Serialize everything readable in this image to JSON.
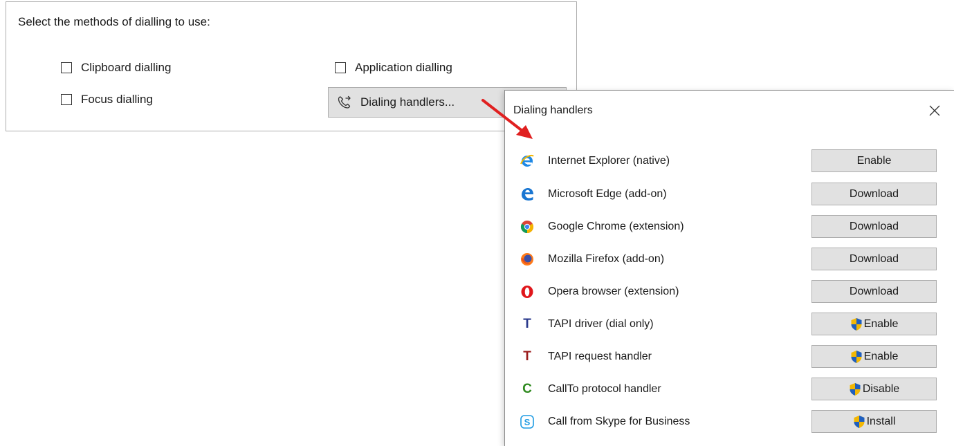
{
  "panel": {
    "title": "Select the methods of dialling to use:",
    "checkboxes": [
      {
        "label": "Clipboard dialling",
        "checked": false
      },
      {
        "label": "Application dialling",
        "checked": false
      },
      {
        "label": "Focus dialling",
        "checked": false
      }
    ],
    "handlers_button": {
      "label": "Dialing handlers...",
      "icon": "phone-forward-icon"
    }
  },
  "dialog": {
    "title": "Dialing handlers",
    "close_icon": "close-icon",
    "rows": [
      {
        "label": "Internet Explorer (native)",
        "button": "Enable",
        "icon": "internet-explorer-icon",
        "shield": false
      },
      {
        "label": "Microsoft Edge (add-on)",
        "button": "Download",
        "icon": "microsoft-edge-icon",
        "shield": false
      },
      {
        "label": "Google Chrome (extension)",
        "button": "Download",
        "icon": "google-chrome-icon",
        "shield": false
      },
      {
        "label": "Mozilla Firefox (add-on)",
        "button": "Download",
        "icon": "mozilla-firefox-icon",
        "shield": false
      },
      {
        "label": "Opera browser (extension)",
        "button": "Download",
        "icon": "opera-icon",
        "shield": false
      },
      {
        "label": "TAPI driver (dial only)",
        "button": "Enable",
        "icon": "tapi-driver-icon",
        "icon_text": "T",
        "icon_color": "#2b3a8c",
        "shield": true
      },
      {
        "label": "TAPI request handler",
        "button": "Enable",
        "icon": "tapi-request-icon",
        "icon_text": "T",
        "icon_color": "#9b1c1c",
        "shield": true
      },
      {
        "label": "CallTo protocol handler",
        "button": "Disable",
        "icon": "callto-icon",
        "icon_text": "C",
        "icon_color": "#2f8a1f",
        "shield": true
      },
      {
        "label": "Call from Skype for Business",
        "button": "Install",
        "icon": "skype-icon",
        "shield": true
      }
    ]
  },
  "colors": {
    "button_bg": "#e1e1e1",
    "arrow": "#e02020",
    "shield_blue": "#1f5fbf",
    "shield_gold": "#f2b705"
  }
}
